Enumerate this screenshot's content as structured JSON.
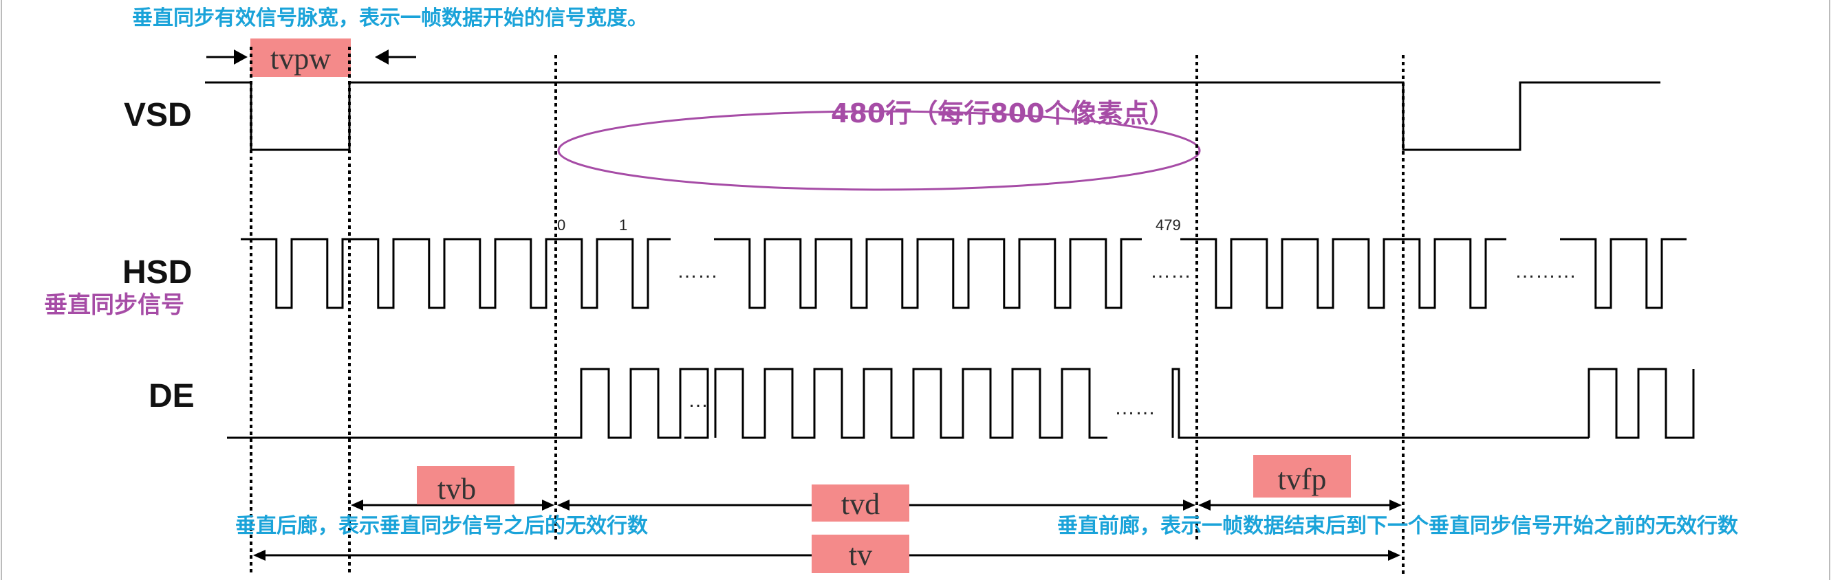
{
  "annotations": {
    "top": "垂直同步有效信号脉宽，表示一帧数据开始的信号宽度。",
    "rows": "480行（每行800个像素点）",
    "hsd_side": "垂直同步信号",
    "back_porch": "垂直后廊，表示垂直同步信号之后的无效行数",
    "front_porch": "垂直前廊，表示一帧数据结束后到下一个垂直同步信号开始之前的无效行数"
  },
  "signals": {
    "vsd": "VSD",
    "hsd": "HSD",
    "de": "DE"
  },
  "timing_labels": {
    "tvpw": "tvpw",
    "tvb": "tvb",
    "tvd": "tvd",
    "tvfp": "tvfp",
    "tv": "tv"
  },
  "line_indices": {
    "first": "0",
    "second": "1",
    "last": "479"
  },
  "ellipsis": {
    "hsd_1": "……",
    "hsd_2": "……",
    "hsd_3": "………",
    "de_1": "…",
    "de_2": "……"
  },
  "colors": {
    "annotation_blue": "#1aa3d9",
    "annotation_purple": "#a64ca6",
    "label_box": "#f48a8a",
    "waveform": "#000000"
  }
}
